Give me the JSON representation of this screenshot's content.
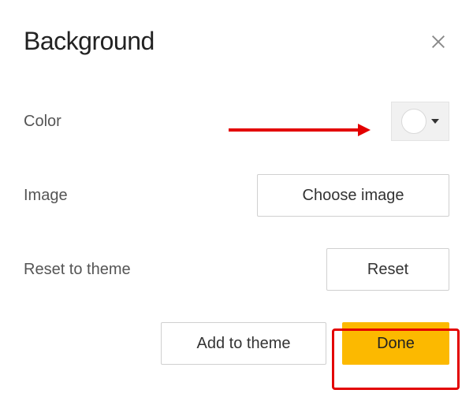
{
  "dialog": {
    "title": "Background",
    "rows": {
      "color_label": "Color",
      "image_label": "Image",
      "reset_label": "Reset to theme"
    },
    "buttons": {
      "choose_image": "Choose image",
      "reset": "Reset",
      "add_to_theme": "Add to theme",
      "done": "Done"
    },
    "color_swatch": {
      "current_color": "#ffffff"
    }
  }
}
